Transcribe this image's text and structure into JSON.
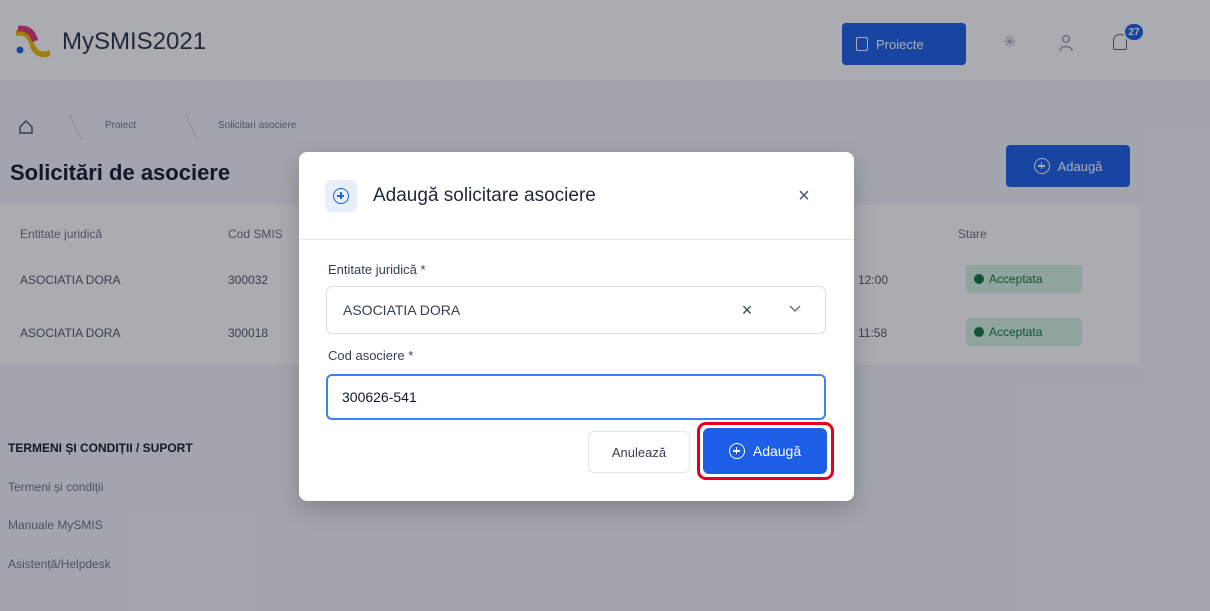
{
  "app": {
    "title": "MySMIS2021",
    "brand_color": "#1c5fe6"
  },
  "topbar": {
    "projects_label": "Proiecte",
    "notifications_count": "27",
    "icons": [
      "settings-icon",
      "user-icon",
      "bell-icon"
    ]
  },
  "breadcrumb": {
    "items": [
      "Proiect",
      "Solicitari asociere"
    ]
  },
  "page": {
    "title": "Solicitări de asociere",
    "add_label": "Adaugă"
  },
  "table": {
    "columns": [
      "Entitate juridică",
      "Cod SMIS",
      "Stare"
    ],
    "rows": [
      {
        "entity": "ASOCIATIA DORA",
        "code": "300032",
        "time": "12:00",
        "status": "Acceptata"
      },
      {
        "entity": "ASOCIATIA DORA",
        "code": "300018",
        "time": "11:58",
        "status": "Acceptata"
      }
    ],
    "status_color": "#11753a"
  },
  "footer": {
    "heading": "TERMENI ȘI CONDIȚII / SUPORT",
    "links": [
      "Termeni și condiții",
      "Manuale MySMIS",
      "Asistență/Helpdesk"
    ]
  },
  "modal": {
    "title": "Adaugă solicitare asociere",
    "entity_label": "Entitate juridică *",
    "entity_value": "ASOCIATIA DORA",
    "code_label": "Cod asociere *",
    "code_value": "300626-541",
    "cancel_label": "Anulează",
    "submit_label": "Adaugă",
    "highlight_color": "#e3001b"
  }
}
